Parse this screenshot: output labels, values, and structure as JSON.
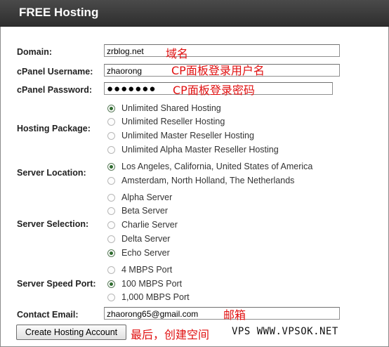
{
  "header": {
    "title": "FREE Hosting"
  },
  "fields": {
    "domain": {
      "label": "Domain:",
      "value": "zrblog.net",
      "note": "域名"
    },
    "username": {
      "label": "cPanel Username:",
      "value": "zhaorong",
      "note": "CP面板登录用户名"
    },
    "password": {
      "label": "cPanel Password:",
      "value": "●●●●●●●",
      "note": "CP面板登录密码"
    },
    "email": {
      "label": "Contact Email:",
      "value": "zhaorong65@gmail.com",
      "note": "邮箱"
    }
  },
  "hosting_package": {
    "label": "Hosting Package:",
    "options": [
      "Unlimited Shared Hosting",
      "Unlimited Reseller Hosting",
      "Unlimited Master Reseller Hosting",
      "Unlimited Alpha Master Reseller Hosting"
    ],
    "selected": "Unlimited Shared Hosting"
  },
  "server_location": {
    "label": "Server Location:",
    "options": [
      "Los Angeles, California, United States of America",
      "Amsterdam, North Holland, The Netherlands"
    ],
    "selected": "Los Angeles, California, United States of America"
  },
  "server_selection": {
    "label": "Server Selection:",
    "options": [
      "Alpha Server",
      "Beta Server",
      "Charlie Server",
      "Delta Server",
      "Echo Server"
    ],
    "selected": "Echo Server"
  },
  "server_speed": {
    "label": "Server Speed Port:",
    "options": [
      "4 MBPS Port",
      "100 MBPS Port",
      "1,000 MBPS Port"
    ],
    "selected": "100 MBPS Port"
  },
  "submit": {
    "label": "Create Hosting Account",
    "note": "最后，创建空间"
  },
  "watermark": "VPS WWW.VPSOK.NET"
}
